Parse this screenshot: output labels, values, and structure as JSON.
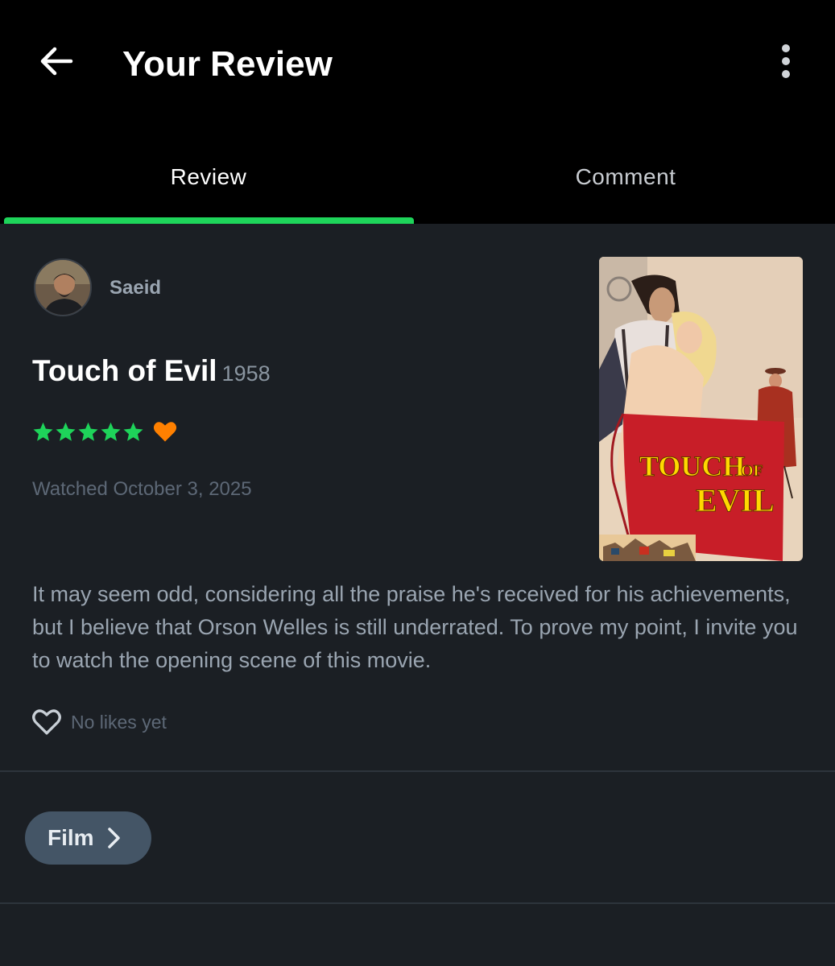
{
  "header": {
    "title": "Your Review",
    "back_icon": "arrow-left-icon",
    "more_icon": "more-vertical-icon"
  },
  "tabs": [
    {
      "label": "Review",
      "active": true
    },
    {
      "label": "Comment",
      "active": false
    }
  ],
  "review": {
    "username": "Saeid",
    "film_title": "Touch of Evil",
    "film_year": "1958",
    "rating_stars": 5,
    "liked": true,
    "watched": "Watched October 3, 2025",
    "text": "It may seem odd, considering all the praise he's received for his achievements, but I believe that Orson Welles is still underrated. To prove my point, I invite you to watch the opening scene of this movie.",
    "likes_text": "No likes yet",
    "poster_text": "TOUCH OF EVIL"
  },
  "footer": {
    "film_button_label": "Film"
  },
  "colors": {
    "accent_green": "#1ed45a",
    "star_green": "#1ed45a",
    "heart_orange": "#ff8000",
    "background": "#1b1f24",
    "header_bg": "#000000"
  }
}
